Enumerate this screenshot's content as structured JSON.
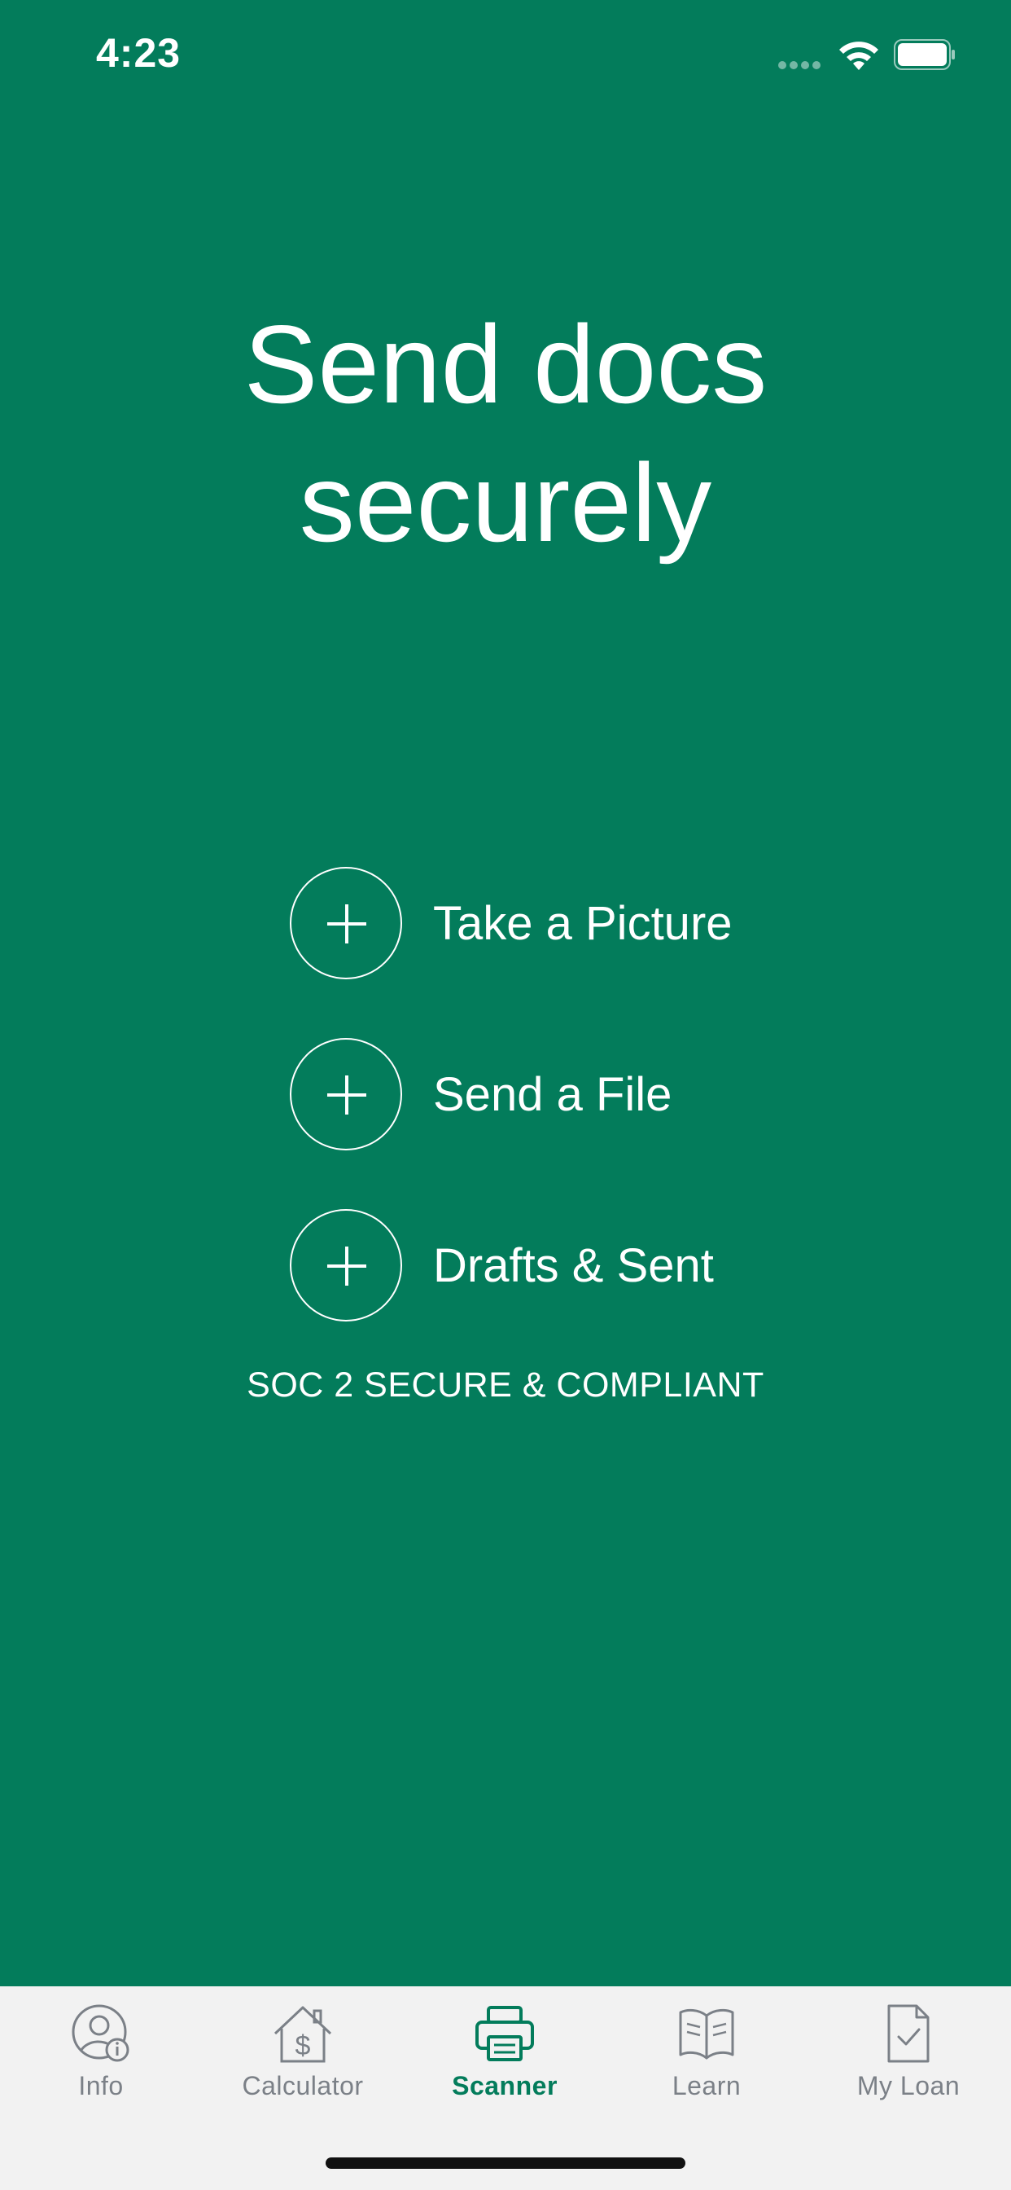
{
  "status_bar": {
    "time": "4:23"
  },
  "hero": {
    "title_line1": "Send docs",
    "title_line2": "securely"
  },
  "actions": [
    {
      "label": "Take a Picture",
      "icon": "plus-icon"
    },
    {
      "label": "Send a File",
      "icon": "plus-icon"
    },
    {
      "label": "Drafts & Sent",
      "icon": "plus-icon"
    }
  ],
  "compliance_text": "SOC 2 SECURE & COMPLIANT",
  "tab_bar": {
    "tabs": [
      {
        "label": "Info",
        "icon": "user-info-icon",
        "active": false
      },
      {
        "label": "Calculator",
        "icon": "house-dollar-icon",
        "active": false
      },
      {
        "label": "Scanner",
        "icon": "printer-icon",
        "active": true
      },
      {
        "label": "Learn",
        "icon": "open-book-icon",
        "active": false
      },
      {
        "label": "My Loan",
        "icon": "document-check-icon",
        "active": false
      }
    ]
  },
  "colors": {
    "background": "#037c5b",
    "accent": "#037c5b",
    "tab_bar_background": "#f2f2f2",
    "tab_inactive": "#7b8087",
    "text": "#ffffff"
  }
}
